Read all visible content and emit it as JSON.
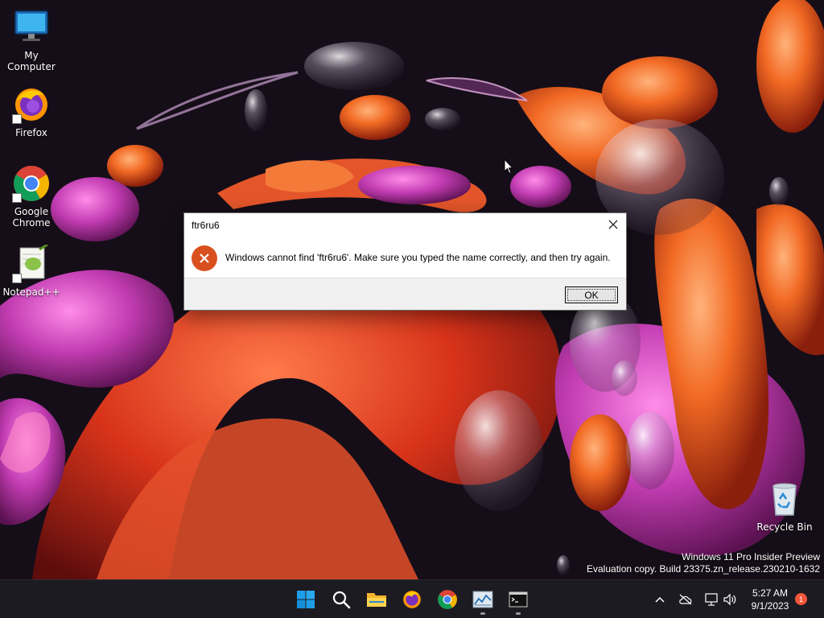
{
  "desktop": {
    "icons": [
      {
        "label": "My Computer",
        "icon": "monitor-icon"
      },
      {
        "label": "Firefox",
        "icon": "firefox-icon"
      },
      {
        "label": "Google Chrome",
        "icon": "chrome-icon"
      },
      {
        "label": "Notepad++",
        "icon": "notepadpp-icon"
      },
      {
        "label": "Recycle Bin",
        "icon": "recycle-bin-icon"
      }
    ]
  },
  "dialog": {
    "title": "ftr6ru6",
    "message": "Windows cannot find 'ftr6ru6'. Make sure you typed the name correctly, and then try again.",
    "ok_label": "OK",
    "icon": "error-icon",
    "close_icon": "close-icon"
  },
  "watermark": {
    "line1": "Windows 11 Pro Insider Preview",
    "line2": "Evaluation copy. Build 23375.zn_release.230210-1632"
  },
  "taskbar": {
    "apps": [
      {
        "name": "start",
        "icon": "windows-start-icon",
        "running": false
      },
      {
        "name": "search",
        "icon": "search-icon",
        "running": false
      },
      {
        "name": "file-explorer",
        "icon": "folder-icon",
        "running": false
      },
      {
        "name": "firefox",
        "icon": "firefox-icon",
        "running": false
      },
      {
        "name": "chrome",
        "icon": "chrome-icon",
        "running": false
      },
      {
        "name": "task-manager",
        "icon": "task-manager-icon",
        "running": true
      },
      {
        "name": "terminal",
        "icon": "terminal-icon",
        "running": true
      }
    ],
    "tray": {
      "icons": [
        "chevron-up-icon",
        "cloud-offline-icon",
        "network-icon",
        "volume-icon"
      ],
      "time": "5:27 AM",
      "date": "9/1/2023",
      "notification_count": "1"
    }
  },
  "colors": {
    "accent": "#0078d4",
    "error": "#d9501f",
    "taskbar": "#1d1b22",
    "notification_badge": "#f2573a"
  }
}
